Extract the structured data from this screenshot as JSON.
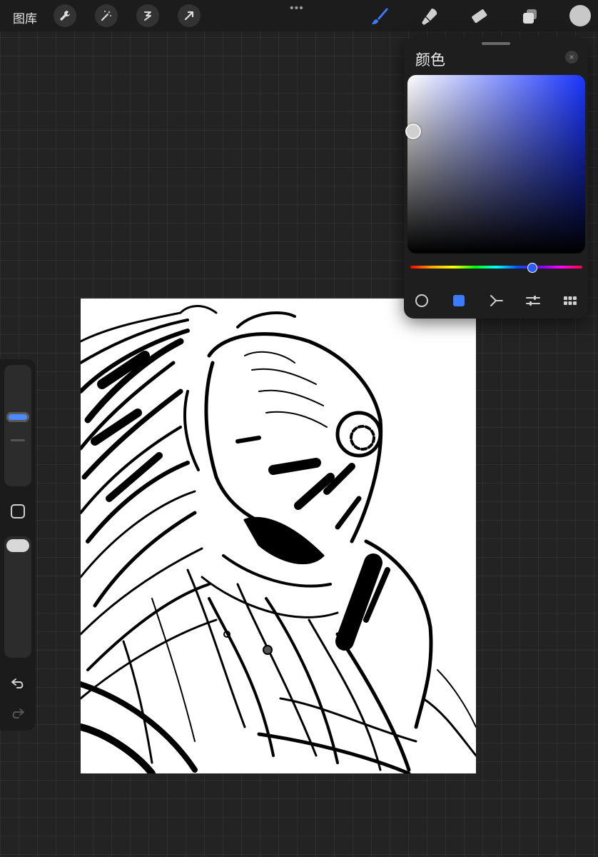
{
  "toolbar": {
    "gallery_label": "图库",
    "left_tools": [
      "wrench-icon",
      "magic-wand-icon",
      "selection-icon",
      "transform-arrow-icon"
    ],
    "more_label": "•••",
    "right_tools": [
      "brush-icon",
      "smudge-icon",
      "eraser-icon",
      "layers-icon"
    ],
    "active_tool": "brush-icon",
    "current_color": "#c8c8c8"
  },
  "color_panel": {
    "title": "颜色",
    "close_label": "×",
    "hue_color": "#1a35ff",
    "selected_mode": "classic",
    "modes": [
      "disc",
      "classic",
      "harmony",
      "value",
      "palettes"
    ]
  },
  "sidebar": {
    "size_slider_icon": "size-slider",
    "opacity_slider_icon": "opacity-slider",
    "modify_button_icon": "square-icon",
    "undo_icon": "undo-icon",
    "redo_icon": "redo-icon"
  },
  "colors": {
    "accent": "#3a7bff",
    "background": "#232323",
    "canvas": "#ffffff"
  }
}
